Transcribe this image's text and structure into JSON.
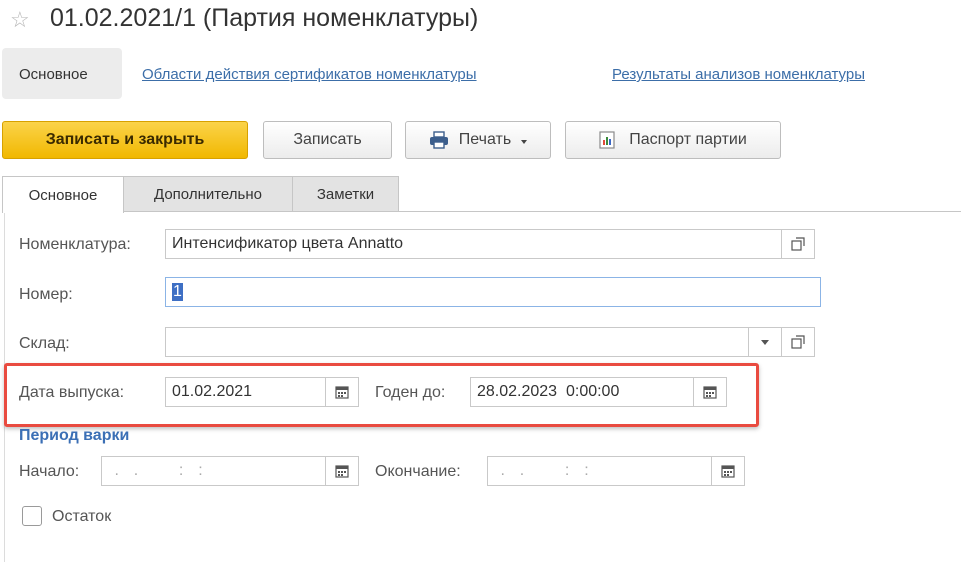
{
  "window": {
    "title": "01.02.2021/1 (Партия номенклатуры)"
  },
  "navbar": {
    "active": "Основное",
    "links": [
      "Области действия сертификатов номенклатуры",
      "Результаты анализов номенклатуры"
    ]
  },
  "toolbar": {
    "save_close": "Записать и закрыть",
    "save": "Записать",
    "print": "Печать",
    "passport": "Паспорт партии"
  },
  "tabs": [
    "Основное",
    "Дополнительно",
    "Заметки"
  ],
  "form": {
    "nomenclature": {
      "label": "Номенклатура:",
      "value": "Интенсификатор цвета Annatto"
    },
    "number": {
      "label": "Номер:",
      "value": "1"
    },
    "warehouse": {
      "label": "Склад:",
      "value": ""
    },
    "release_date": {
      "label": "Дата выпуска:",
      "value": "01.02.2021"
    },
    "valid_until": {
      "label": "Годен до:",
      "value": "28.02.2023  0:00:00"
    },
    "cooking_period": {
      "title": "Период варки",
      "start": {
        "label": "Начало:",
        "value": " .  .      :  :"
      },
      "end": {
        "label": "Окончание:",
        "value": " .  .      :  :"
      }
    },
    "remainder": {
      "label": "Остаток",
      "checked": false
    }
  },
  "icons": {
    "favorite": "star-icon",
    "open": "open-form-icon",
    "calendar": "calendar-icon",
    "printer": "printer-icon",
    "report": "report-icon",
    "dropdown": "chevron-down-icon"
  },
  "colors": {
    "accent": "#f1b800",
    "link": "#3c6ea8",
    "section": "#3b6fb5",
    "highlight": "#e94b40"
  }
}
